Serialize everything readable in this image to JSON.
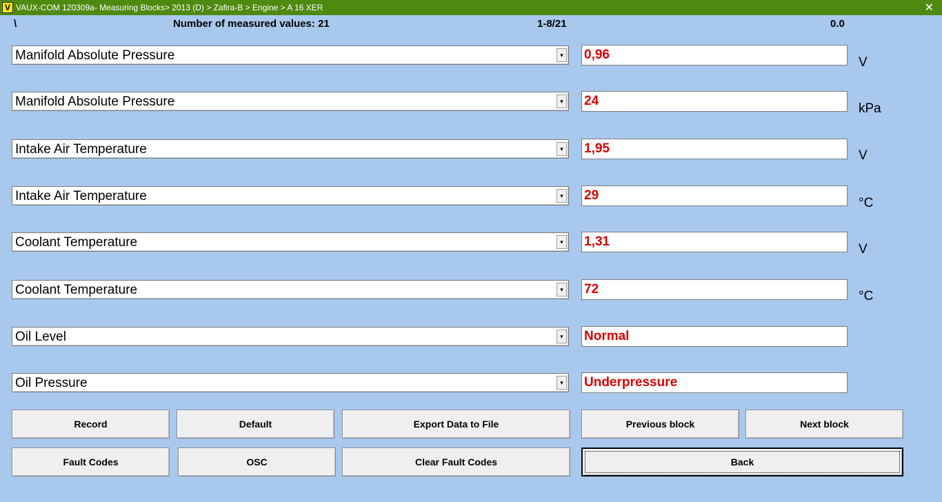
{
  "window": {
    "app_icon": "V",
    "title": "VAUX-COM 120309a- Measuring Blocks> 2013 (D) > Zafira-B > Engine > A 16 XER",
    "close": "✕"
  },
  "header": {
    "indicator": "\\",
    "measured_count": "Number of measured values: 21",
    "range": "1-8/21",
    "value": "0.0"
  },
  "rows": [
    {
      "label": "Manifold Absolute Pressure",
      "value": "0,96",
      "unit": "V"
    },
    {
      "label": "Manifold Absolute Pressure",
      "value": "24",
      "unit": "kPa"
    },
    {
      "label": "Intake Air Temperature",
      "value": "1,95",
      "unit": "V"
    },
    {
      "label": "Intake Air Temperature",
      "value": "29",
      "unit": "°C"
    },
    {
      "label": "Coolant Temperature",
      "value": "1,31",
      "unit": "V"
    },
    {
      "label": "Coolant Temperature",
      "value": "72",
      "unit": "°C"
    },
    {
      "label": "Oil Level",
      "value": "Normal",
      "unit": ""
    },
    {
      "label": "Oil Pressure",
      "value": "Underpressure",
      "unit": ""
    }
  ],
  "combo_arrow": "▾",
  "buttons": {
    "record": "Record",
    "default": "Default",
    "export": "Export Data to File",
    "previous": "Previous block",
    "next": "Next block",
    "fault_codes": "Fault Codes",
    "osc": "OSC",
    "clear_fault_codes": "Clear Fault Codes",
    "back": "Back"
  },
  "colors": {
    "titlebar": "#4f8a10",
    "background": "#a9c8ee",
    "value_text": "#e00000"
  }
}
